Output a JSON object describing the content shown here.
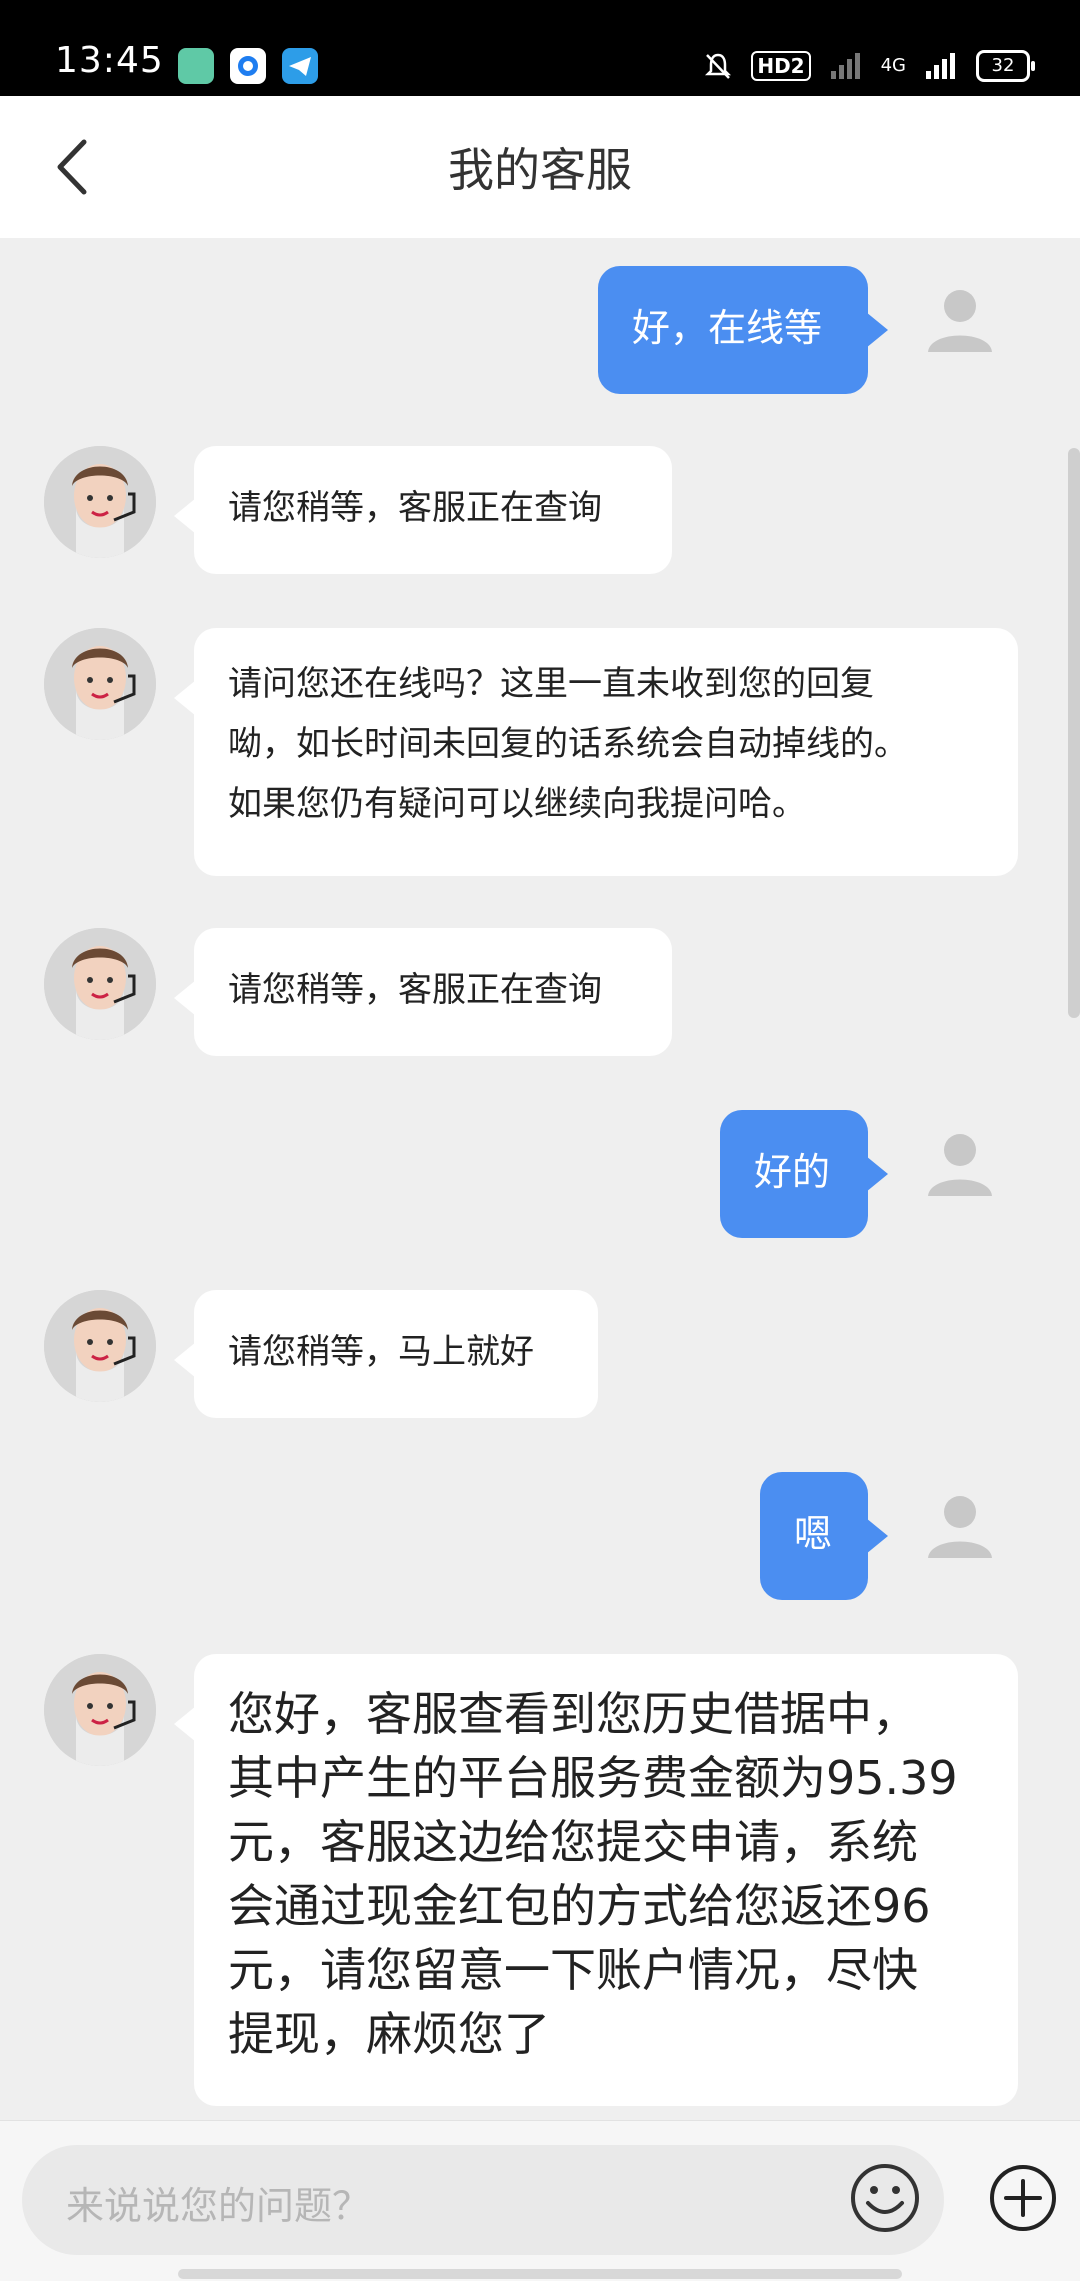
{
  "status_bar": {
    "time": "13:45",
    "hd_label": "HD2",
    "network": "4G",
    "battery": "32"
  },
  "header": {
    "title": "我的客服"
  },
  "messages": [
    {
      "side": "right",
      "text": "好，在线等"
    },
    {
      "side": "left",
      "text": "请您稍等，客服正在查询"
    },
    {
      "side": "left",
      "lines": [
        "请问您还在线吗？这里一直未收到您的回复",
        "呦，如长时间未回复的话系统会自动掉线的。",
        "如果您仍有疑问可以继续向我提问哈。"
      ]
    },
    {
      "side": "left",
      "text": "请您稍等，客服正在查询"
    },
    {
      "side": "right",
      "text": "好的"
    },
    {
      "side": "left",
      "text": "请您稍等，马上就好"
    },
    {
      "side": "right",
      "text": "嗯"
    },
    {
      "side": "left",
      "lines": [
        "您好，客服查看到您历史借据中，",
        "其中产生的平台服务费金额为95.39",
        "元，客服这边给您提交申请，系统",
        "会通过现金红包的方式给您返还96",
        "元，请您留意一下账户情况，尽快",
        "提现，麻烦您了"
      ]
    }
  ],
  "input": {
    "placeholder": "来说说您的问题？"
  },
  "icons": {
    "back": "chevron-left-icon",
    "user": "user-avatar-icon",
    "agent": "agent-avatar-icon",
    "emoji": "smiley-icon",
    "add": "plus-circle-icon"
  },
  "colors": {
    "user_bubble": "#4b8ef1",
    "agent_bubble": "#ffffff",
    "background": "#efefef"
  }
}
